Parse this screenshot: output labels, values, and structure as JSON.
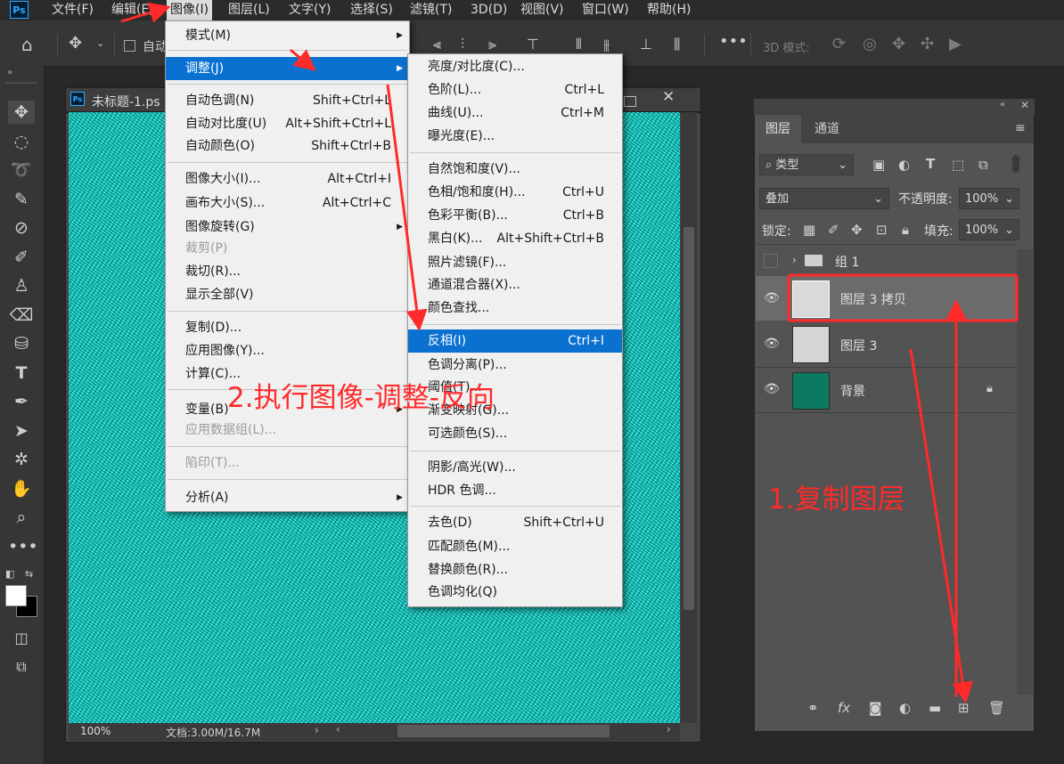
{
  "menubar": {
    "logo": "Ps",
    "items": [
      "文件(F)",
      "编辑(E)",
      "图像(I)",
      "图层(L)",
      "文字(Y)",
      "选择(S)",
      "滤镜(T)",
      "3D(D)",
      "视图(V)",
      "窗口(W)",
      "帮助(H)"
    ],
    "active_index": 2
  },
  "options_bar": {
    "auto_select_label": "自动",
    "mode_3d_label": "3D 模式:"
  },
  "document": {
    "tab_title": "未标题-1.ps",
    "zoom": "100%",
    "doc_info": "文档:3.00M/16.7M",
    "canvas_color": "#26e8df"
  },
  "image_menu": {
    "items": [
      {
        "label": "模式(M)",
        "shortcut": "",
        "submenu": true,
        "disabled": false
      },
      {
        "label": "调整(J)",
        "shortcut": "",
        "submenu": true,
        "disabled": false,
        "highlighted": true
      },
      {
        "label": "自动色调(N)",
        "shortcut": "Shift+Ctrl+L",
        "submenu": false,
        "disabled": false
      },
      {
        "label": "自动对比度(U)",
        "shortcut": "Alt+Shift+Ctrl+L",
        "submenu": false,
        "disabled": false
      },
      {
        "label": "自动颜色(O)",
        "shortcut": "Shift+Ctrl+B",
        "submenu": false,
        "disabled": false
      },
      {
        "label": "图像大小(I)...",
        "shortcut": "Alt+Ctrl+I",
        "submenu": false,
        "disabled": false
      },
      {
        "label": "画布大小(S)...",
        "shortcut": "Alt+Ctrl+C",
        "submenu": false,
        "disabled": false
      },
      {
        "label": "图像旋转(G)",
        "shortcut": "",
        "submenu": true,
        "disabled": false
      },
      {
        "label": "裁剪(P)",
        "shortcut": "",
        "submenu": false,
        "disabled": true
      },
      {
        "label": "裁切(R)...",
        "shortcut": "",
        "submenu": false,
        "disabled": false
      },
      {
        "label": "显示全部(V)",
        "shortcut": "",
        "submenu": false,
        "disabled": false
      },
      {
        "label": "复制(D)...",
        "shortcut": "",
        "submenu": false,
        "disabled": false
      },
      {
        "label": "应用图像(Y)...",
        "shortcut": "",
        "submenu": false,
        "disabled": false
      },
      {
        "label": "计算(C)...",
        "shortcut": "",
        "submenu": false,
        "disabled": false
      },
      {
        "label": "变量(B)",
        "shortcut": "",
        "submenu": true,
        "disabled": false
      },
      {
        "label": "应用数据组(L)...",
        "shortcut": "",
        "submenu": false,
        "disabled": true
      },
      {
        "label": "陷印(T)...",
        "shortcut": "",
        "submenu": false,
        "disabled": true
      },
      {
        "label": "分析(A)",
        "shortcut": "",
        "submenu": true,
        "disabled": false
      }
    ]
  },
  "adjust_menu": {
    "items": [
      {
        "label": "亮度/对比度(C)...",
        "shortcut": ""
      },
      {
        "label": "色阶(L)...",
        "shortcut": "Ctrl+L"
      },
      {
        "label": "曲线(U)...",
        "shortcut": "Ctrl+M"
      },
      {
        "label": "曝光度(E)...",
        "shortcut": ""
      },
      {
        "label": "自然饱和度(V)...",
        "shortcut": ""
      },
      {
        "label": "色相/饱和度(H)...",
        "shortcut": "Ctrl+U"
      },
      {
        "label": "色彩平衡(B)...",
        "shortcut": "Ctrl+B"
      },
      {
        "label": "黑白(K)...",
        "shortcut": "Alt+Shift+Ctrl+B"
      },
      {
        "label": "照片滤镜(F)...",
        "shortcut": ""
      },
      {
        "label": "通道混合器(X)...",
        "shortcut": ""
      },
      {
        "label": "颜色查找...",
        "shortcut": ""
      },
      {
        "label": "反相(I)",
        "shortcut": "Ctrl+I",
        "highlighted": true
      },
      {
        "label": "色调分离(P)...",
        "shortcut": ""
      },
      {
        "label": "阈值(T)...",
        "shortcut": ""
      },
      {
        "label": "渐变映射(G)...",
        "shortcut": ""
      },
      {
        "label": "可选颜色(S)...",
        "shortcut": ""
      },
      {
        "label": "阴影/高光(W)...",
        "shortcut": ""
      },
      {
        "label": "HDR 色调...",
        "shortcut": ""
      },
      {
        "label": "去色(D)",
        "shortcut": "Shift+Ctrl+U"
      },
      {
        "label": "匹配颜色(M)...",
        "shortcut": ""
      },
      {
        "label": "替换颜色(R)...",
        "shortcut": ""
      },
      {
        "label": "色调均化(Q)",
        "shortcut": ""
      }
    ]
  },
  "layers_panel": {
    "tabs": [
      "图层",
      "通道"
    ],
    "filter_label": "类型",
    "blend_mode": "叠加",
    "opacity_label": "不透明度:",
    "opacity_value": "100%",
    "lock_label": "锁定:",
    "fill_label": "填充:",
    "fill_value": "100%",
    "layers": [
      {
        "name": "组 1",
        "type": "group",
        "visible": false
      },
      {
        "name": "图层 3 拷贝",
        "type": "noise",
        "visible": true,
        "selected": true
      },
      {
        "name": "图层 3",
        "type": "noise",
        "visible": true
      },
      {
        "name": "背景",
        "type": "fill",
        "visible": true,
        "locked": true,
        "color": "#0c7a63"
      }
    ]
  },
  "annotations": {
    "step1": "1.复制图层",
    "step2": "2.执行图像-调整-反向",
    "color": "#ff2a2a"
  }
}
